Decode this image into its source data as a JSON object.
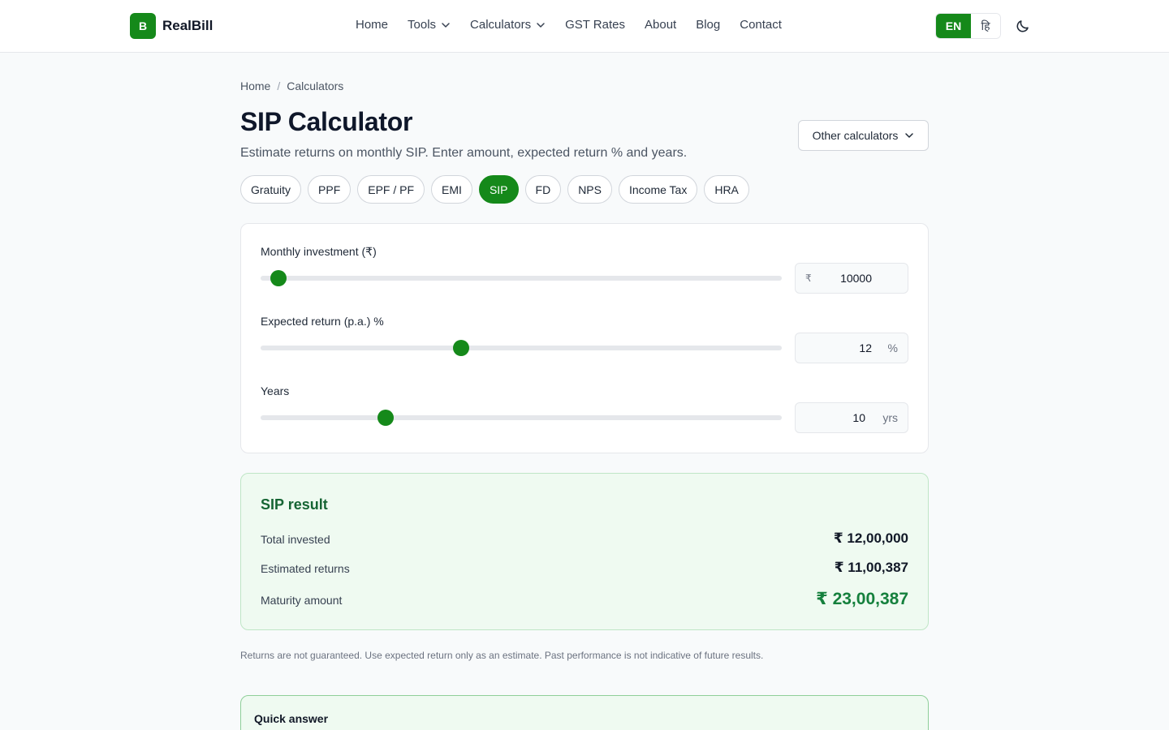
{
  "brand": {
    "mark": "B",
    "name": "RealBill"
  },
  "nav": [
    {
      "label": "Home",
      "dropdown": false
    },
    {
      "label": "Tools",
      "dropdown": true
    },
    {
      "label": "Calculators",
      "dropdown": true
    },
    {
      "label": "GST Rates",
      "dropdown": false
    },
    {
      "label": "About",
      "dropdown": false
    },
    {
      "label": "Blog",
      "dropdown": false
    },
    {
      "label": "Contact",
      "dropdown": false
    }
  ],
  "language": {
    "en": "EN",
    "hi": "हि",
    "selected": "EN"
  },
  "breadcrumb": {
    "home": "Home",
    "separator": "/",
    "current": "Calculators"
  },
  "page": {
    "title": "SIP Calculator",
    "subtitle": "Estimate returns on monthly SIP. Enter amount, expected return % and years.",
    "other_calculators": "Other calculators"
  },
  "tabs": [
    {
      "label": "Gratuity",
      "active": false
    },
    {
      "label": "PPF",
      "active": false
    },
    {
      "label": "EPF / PF",
      "active": false
    },
    {
      "label": "EMI",
      "active": false
    },
    {
      "label": "SIP",
      "active": true
    },
    {
      "label": "FD",
      "active": false
    },
    {
      "label": "NPS",
      "active": false
    },
    {
      "label": "Income Tax",
      "active": false
    },
    {
      "label": "HRA",
      "active": false
    }
  ],
  "inputs": {
    "monthly": {
      "label": "Monthly investment (₹)",
      "prefix": "₹",
      "value": "10000",
      "slider_fraction": 0.034
    },
    "return": {
      "label": "Expected return (p.a.) %",
      "value": "12",
      "suffix": "%",
      "slider_fraction": 0.384
    },
    "years": {
      "label": "Years",
      "value": "10",
      "suffix": "yrs",
      "slider_fraction": 0.24
    }
  },
  "result": {
    "title": "SIP result",
    "total_invested_label": "Total invested",
    "total_invested": "₹ 12,00,000",
    "estimated_returns_label": "Estimated returns",
    "estimated_returns": "₹ 11,00,387",
    "maturity_label": "Maturity amount",
    "maturity": "₹ 23,00,387"
  },
  "disclaimer": "Returns are not guaranteed. Use expected return only as an estimate. Past performance is not indicative of future results.",
  "quick_answer": {
    "title": "Quick answer"
  },
  "colors": {
    "accent": "#15891a",
    "result_bg": "#effaf1",
    "maturity": "#15803d"
  }
}
